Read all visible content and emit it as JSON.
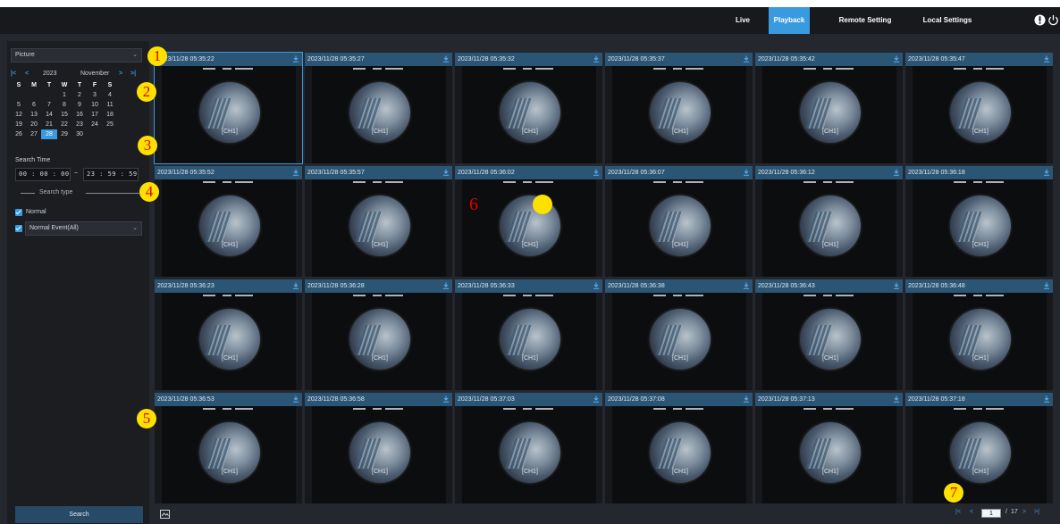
{
  "topbar": {
    "tabs": [
      {
        "label": "Live"
      },
      {
        "label": "Playback",
        "active": true
      },
      {
        "label": "Remote Setting"
      },
      {
        "label": "Local Settings"
      }
    ],
    "icons": [
      "info-icon",
      "power-icon"
    ]
  },
  "sidebar": {
    "mode": "Picture",
    "calendar": {
      "year": "2023",
      "month": "November",
      "weekdays": [
        "S",
        "M",
        "T",
        "W",
        "T",
        "F",
        "S"
      ],
      "weeks": [
        [
          "",
          "",
          "",
          "1",
          "2",
          "3",
          "4"
        ],
        [
          "5",
          "6",
          "7",
          "8",
          "9",
          "10",
          "11"
        ],
        [
          "12",
          "13",
          "14",
          "15",
          "16",
          "17",
          "18"
        ],
        [
          "19",
          "20",
          "21",
          "22",
          "23",
          "24",
          "25"
        ],
        [
          "26",
          "27",
          "28",
          "29",
          "30",
          "",
          ""
        ]
      ],
      "selected_day": "28"
    },
    "search_time_label": "Search Time",
    "start_time": "00 : 00 : 00",
    "time_sep": "~",
    "end_time": "23 : 59 : 59",
    "search_type_label": "Search type",
    "normal_label": "Normal",
    "event_select": "Normal Event(All)",
    "search_button": "Search"
  },
  "thumbnails": [
    {
      "time": "2023/11/28 05:35:22",
      "ch": "[CH1]"
    },
    {
      "time": "2023/11/28 05:35:27",
      "ch": "[CH1]"
    },
    {
      "time": "2023/11/28 05:35:32",
      "ch": "[CH1]"
    },
    {
      "time": "2023/11/28 05:35:37",
      "ch": "[CH1]"
    },
    {
      "time": "2023/11/28 05:35:42",
      "ch": "[CH1]"
    },
    {
      "time": "2023/11/28 05:35:47",
      "ch": "[CH1]"
    },
    {
      "time": "2023/11/28 05:35:52",
      "ch": "[CH1]"
    },
    {
      "time": "2023/11/28 05:35:57",
      "ch": "[CH1]"
    },
    {
      "time": "2023/11/28 05:36:02",
      "ch": "[CH1]"
    },
    {
      "time": "2023/11/28 05:36:07",
      "ch": "[CH1]"
    },
    {
      "time": "2023/11/28 05:36:12",
      "ch": "[CH1]"
    },
    {
      "time": "2023/11/28 05:36:18",
      "ch": "[CH1]"
    },
    {
      "time": "2023/11/28 05:36:23",
      "ch": "[CH1]"
    },
    {
      "time": "2023/11/28 05:36:28",
      "ch": "[CH1]"
    },
    {
      "time": "2023/11/28 05:36:33",
      "ch": "[CH1]"
    },
    {
      "time": "2023/11/28 05:36:38",
      "ch": "[CH1]"
    },
    {
      "time": "2023/11/28 05:36:43",
      "ch": "[CH1]"
    },
    {
      "time": "2023/11/28 05:36:48",
      "ch": "[CH1]"
    },
    {
      "time": "2023/11/28 05:36:53",
      "ch": "[CH1]"
    },
    {
      "time": "2023/11/28 05:36:58",
      "ch": "[CH1]"
    },
    {
      "time": "2023/11/28 05:37:03",
      "ch": "[CH1]"
    },
    {
      "time": "2023/11/28 05:37:08",
      "ch": "[CH1]"
    },
    {
      "time": "2023/11/28 05:37:13",
      "ch": "[CH1]"
    },
    {
      "time": "2023/11/28 05:37:18",
      "ch": "[CH1]"
    }
  ],
  "pagination": {
    "current": "1",
    "sep": "/",
    "total": "17"
  },
  "annotations": [
    "1",
    "2",
    "3",
    "4",
    "5",
    "6",
    "7"
  ],
  "colors": {
    "accent": "#3a9ae0",
    "thumb_header": "#2a5575",
    "marker_fill": "#ffe100",
    "marker_text": "#e00000"
  }
}
